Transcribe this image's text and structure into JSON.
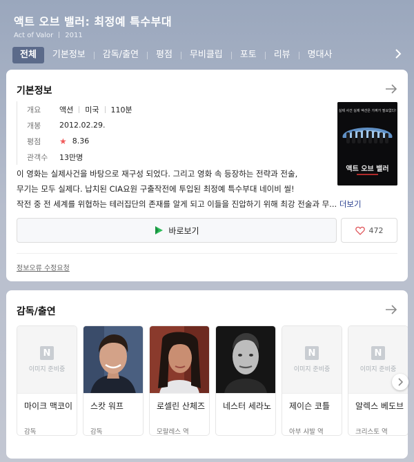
{
  "header": {
    "title": "액트 오브 밸러: 최정예 특수부대",
    "original_title": "Act of Valor",
    "year": "2011"
  },
  "tabs": [
    {
      "label": "전체",
      "active": true
    },
    {
      "label": "기본정보"
    },
    {
      "label": "감독/출연"
    },
    {
      "label": "평점"
    },
    {
      "label": "무비클립"
    },
    {
      "label": "포토"
    },
    {
      "label": "리뷰"
    },
    {
      "label": "명대사"
    }
  ],
  "basic_info": {
    "section_title": "기본정보",
    "overview_label": "개요",
    "genre": "액션",
    "country": "미국",
    "runtime": "110분",
    "release_label": "개봉",
    "release_date": "2012.02.29.",
    "rating_label": "평점",
    "rating": "8.36",
    "audience_label": "관객수",
    "audience": "13만명",
    "synopsis_lines": [
      "이 영화는 실제사건을 바탕으로 재구성 되었다. 그리고 영화 속 등장하는 전략과 전술,",
      "무기는 모두 실제다. 납치된 CIA요원 구출작전에 투입된 최정예 특수부대 네이비 씰!",
      "작전 중 전 세계를 위협하는 테러집단의 존재를 알게 되고 이들을 진압하기 위해 최강 전술과 무..."
    ],
    "more_label": "더보기",
    "watch_label": "바로보기",
    "like_count": "472",
    "report_label": "정보오류 수정요청",
    "poster_texts": {
      "tagline": "실제 사건 실제 액션은 가짜가 필요없다!",
      "title": "액트 오브 밸러"
    }
  },
  "cast": {
    "section_title": "감독/출연",
    "placeholder_text": "이미지 준비중",
    "people": [
      {
        "name": "마이크 맥코이",
        "role": "감독",
        "has_photo": false
      },
      {
        "name": "스캇 워프",
        "role": "감독",
        "has_photo": true
      },
      {
        "name": "로셀린 산체즈",
        "role": "모랄레스 역",
        "has_photo": true
      },
      {
        "name": "네스터 세라노",
        "role": "",
        "has_photo": true
      },
      {
        "name": "제이슨 코틀",
        "role": "아부 샤발 역",
        "has_photo": false
      },
      {
        "name": "알렉스 베도브",
        "role": "크리스토 역",
        "has_photo": false
      }
    ]
  },
  "colors": {
    "active_tab": "#5b6a8a",
    "star": "#f05a5a",
    "link": "#2a3f8f",
    "play_green": "#2fbd5a"
  },
  "icons": [
    "chevron-right-icon",
    "arrow-right-icon",
    "play-icon",
    "heart-icon",
    "star-icon",
    "n-logo-icon"
  ]
}
